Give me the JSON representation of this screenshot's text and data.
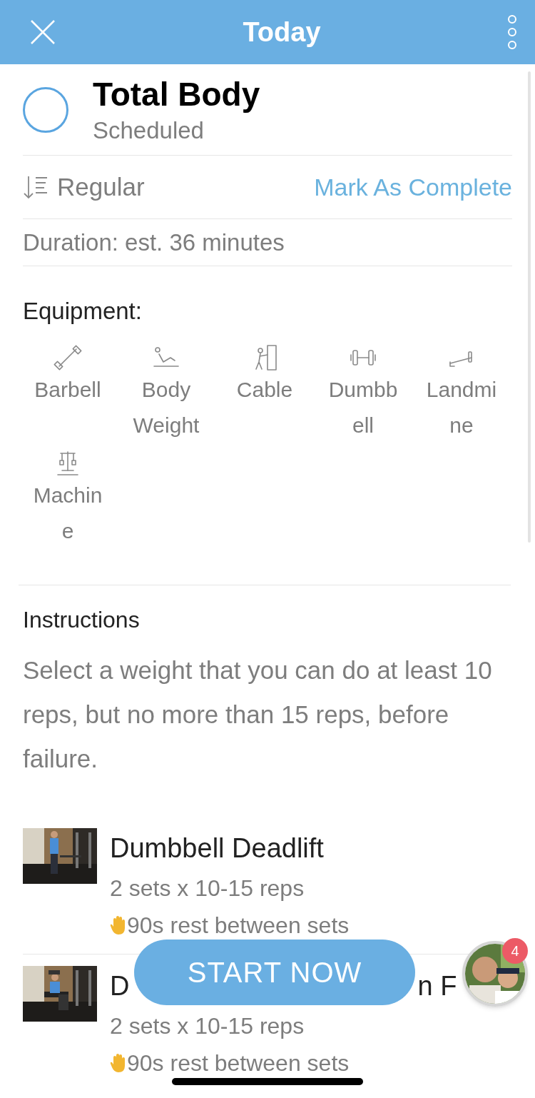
{
  "header": {
    "title": "Today"
  },
  "workout": {
    "name": "Total Body",
    "status": "Scheduled",
    "completed": false
  },
  "order": {
    "label": "Regular"
  },
  "mark_complete": "Mark As Complete",
  "duration": "Duration: est. 36 minutes",
  "equipment": {
    "heading": "Equipment:",
    "items": [
      {
        "kind": "barbell",
        "lines": [
          "Barbell"
        ]
      },
      {
        "kind": "bodyweight",
        "lines": [
          "Body",
          "Weight"
        ]
      },
      {
        "kind": "cable",
        "lines": [
          "Cable"
        ]
      },
      {
        "kind": "dumbbell",
        "lines": [
          "Dumbb",
          "ell"
        ]
      },
      {
        "kind": "landmine",
        "lines": [
          "Landmi",
          "ne"
        ]
      },
      {
        "kind": "machine",
        "lines": [
          "Machin",
          "e"
        ]
      }
    ]
  },
  "instructions": {
    "heading": "Instructions",
    "text": "Select a weight that you can do at least 10 reps, but no more than 15 reps, before failure."
  },
  "exercises": [
    {
      "name_parts": [
        "Dumbbell Deadlift"
      ],
      "sets": "2 sets x 10-15 reps",
      "rest": "90s rest between sets",
      "thumbnail": {
        "kind": "picture"
      }
    },
    {
      "name_parts": [
        "D",
        "n F"
      ],
      "sets": "2 sets x 10-15 reps",
      "rest": "90s rest between sets",
      "thumbnail": {
        "kind": "picture"
      }
    }
  ],
  "start_button": "START NOW",
  "chat": {
    "badge": "4"
  }
}
